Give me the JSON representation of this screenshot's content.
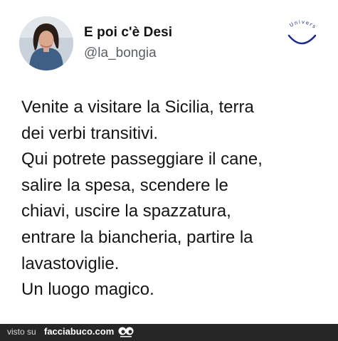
{
  "author": {
    "display_name": "E poi c'è Desi",
    "handle": "@la_bongia"
  },
  "watermark": {
    "logo_text": "Univers",
    "logo_icon": "smile-arc-logo"
  },
  "tweet": {
    "lines": [
      "Venite a visitare la Sicilia, terra",
      "dei verbi transitivi.",
      "Qui potrete passeggiare il cane,",
      "salire la spesa, scendere le",
      "chiavi, uscire la spazzatura,",
      "entrare la biancheria, partire la",
      "lavastoviglie.",
      "Un luogo magico."
    ]
  },
  "footer": {
    "prefix": "visto su",
    "site": "facciabuco.com",
    "icon": "eyes-icon"
  },
  "colors": {
    "background": "#ffffff",
    "text": "#151515",
    "handle": "#5a5f64",
    "footer_bg": "#262626",
    "logo_blue": "#1d2a8a"
  }
}
